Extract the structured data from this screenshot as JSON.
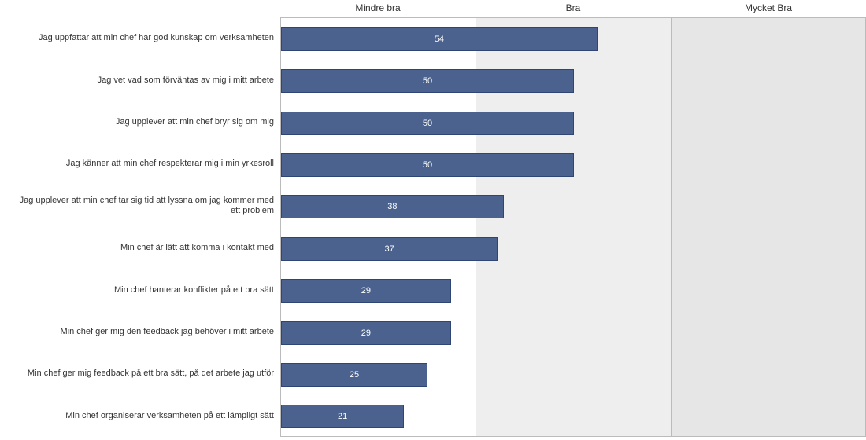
{
  "chart_data": {
    "type": "bar",
    "orientation": "horizontal",
    "x_range": [
      0,
      100
    ],
    "header_labels": [
      "Mindre bra",
      "Bra",
      "Mycket Bra"
    ],
    "bands": [
      {
        "from": 0,
        "to": 33.333,
        "label": "Mindre bra"
      },
      {
        "from": 33.333,
        "to": 66.666,
        "label": "Bra"
      },
      {
        "from": 66.666,
        "to": 100,
        "label": "Mycket Bra"
      }
    ],
    "categories": [
      "Jag uppfattar att min chef har god kunskap om verksamheten",
      "Jag vet vad som förväntas av mig i mitt arbete",
      "Jag upplever att min chef bryr sig om mig",
      "Jag känner att min chef respekterar mig i min yrkesroll",
      "Jag upplever att min chef tar sig tid att lyssna om jag kommer med ett problem",
      "Min chef är lätt att komma i kontakt med",
      "Min chef hanterar konflikter på ett bra sätt",
      "Min chef ger mig den feedback jag behöver i mitt arbete",
      "Min chef ger mig feedback på ett bra sätt, på det arbete jag utför",
      "Min chef organiserar verksamheten på ett lämpligt sätt"
    ],
    "values": [
      54,
      50,
      50,
      50,
      38,
      37,
      29,
      29,
      25,
      21
    ],
    "bar_color": "#4a628d"
  }
}
